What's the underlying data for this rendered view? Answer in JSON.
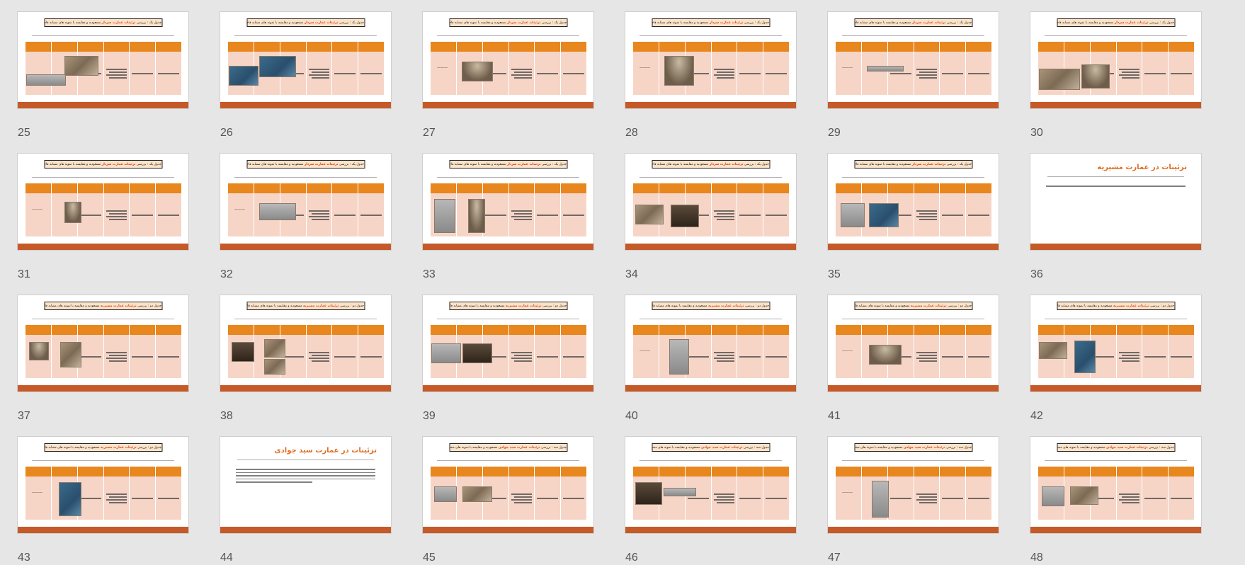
{
  "slides": [
    {
      "num": "25",
      "kind": "table",
      "title_pre": "جدول یک : بررسی",
      "title_hl": "تزئینات عمارت سردار",
      "title_post": "مسعودیه و مقایسه با نمونه های مشابه قاجاری"
    },
    {
      "num": "26",
      "kind": "table",
      "title_pre": "جدول یک : بررسی",
      "title_hl": "تزئینات عمارت سردار",
      "title_post": "مسعودیه و مقایسه با نمونه های مشابه قاجاری"
    },
    {
      "num": "27",
      "kind": "table",
      "title_pre": "جدول یک : بررسی",
      "title_hl": "تزئینات عمارت سردار",
      "title_post": "مسعودیه و مقایسه با نمونه های مشابه قاجاری"
    },
    {
      "num": "28",
      "kind": "table",
      "title_pre": "جدول یک : بررسی",
      "title_hl": "تزئینات عمارت سردار",
      "title_post": "مسعودیه و مقایسه با نمونه های مشابه قاجاری"
    },
    {
      "num": "29",
      "kind": "table",
      "title_pre": "جدول یک : بررسی",
      "title_hl": "تزئینات عمارت سردار",
      "title_post": "مسعودیه و مقایسه با نمونه های مشابه قاجاری"
    },
    {
      "num": "30",
      "kind": "table",
      "title_pre": "جدول یک : بررسی",
      "title_hl": "تزئینات عمارت سردار",
      "title_post": "مسعودیه و مقایسه با نمونه های مشابه قاجاری"
    },
    {
      "num": "31",
      "kind": "table",
      "title_pre": "جدول یک : بررسی",
      "title_hl": "تزئینات عمارت سردار",
      "title_post": "مسعودیه و مقایسه با نمونه های مشابه قاجاری"
    },
    {
      "num": "32",
      "kind": "table",
      "title_pre": "جدول یک : بررسی",
      "title_hl": "تزئینات عمارت سردار",
      "title_post": "مسعودیه و مقایسه با نمونه های مشابه قاجاری"
    },
    {
      "num": "33",
      "kind": "table",
      "title_pre": "جدول یک : بررسی",
      "title_hl": "تزئینات عمارت سردار",
      "title_post": "مسعودیه و مقایسه با نمونه های مشابه قاجاری"
    },
    {
      "num": "34",
      "kind": "table",
      "title_pre": "جدول یک : بررسی",
      "title_hl": "تزئینات عمارت سردار",
      "title_post": "مسعودیه و مقایسه با نمونه های مشابه قاجاری"
    },
    {
      "num": "35",
      "kind": "table",
      "title_pre": "جدول یک : بررسی",
      "title_hl": "تزئینات عمارت سردار",
      "title_post": "مسعودیه و مقایسه با نمونه های مشابه قاجاری"
    },
    {
      "num": "36",
      "kind": "heading",
      "heading": "تزئینات در عمارت مشیریه"
    },
    {
      "num": "37",
      "kind": "table",
      "title_pre": "جدول دو : بررسی",
      "title_hl": "تزئینات عمارت مشیریه",
      "title_post": "مسعودیه و مقایسه با نمونه های مشابه قاجاری"
    },
    {
      "num": "38",
      "kind": "table",
      "title_pre": "جدول دو : بررسی",
      "title_hl": "تزئینات عمارت مشیریه",
      "title_post": "مسعودیه و مقایسه با نمونه های مشابه قاجاری"
    },
    {
      "num": "39",
      "kind": "table",
      "title_pre": "جدول دو : بررسی",
      "title_hl": "تزئینات عمارت مشیریه",
      "title_post": "مسعودیه و مقایسه با نمونه های مشابه قاجاری"
    },
    {
      "num": "40",
      "kind": "table",
      "title_pre": "جدول دو : بررسی",
      "title_hl": "تزئینات عمارت مشیریه",
      "title_post": "مسعودیه و مقایسه با نمونه های مشابه قاجاری"
    },
    {
      "num": "41",
      "kind": "table",
      "title_pre": "جدول دو : بررسی",
      "title_hl": "تزئینات عمارت مشیریه",
      "title_post": "مسعودیه و مقایسه با نمونه های مشابه قاجاری"
    },
    {
      "num": "42",
      "kind": "table",
      "title_pre": "جدول دو : بررسی",
      "title_hl": "تزئینات عمارت مشیریه",
      "title_post": "مسعودیه و مقایسه با نمونه های مشابه قاجاری"
    },
    {
      "num": "43",
      "kind": "table",
      "title_pre": "جدول دو : بررسی",
      "title_hl": "تزئینات عمارت مشیریه",
      "title_post": "مسعودیه و مقایسه با نمونه های مشابه قاجاری"
    },
    {
      "num": "44",
      "kind": "heading",
      "heading": "تزئینات در عمارت سید جوادی"
    },
    {
      "num": "45",
      "kind": "table",
      "title_pre": "جدول سه : بررسی",
      "title_hl": "تزئینات عمارت سید جوادی",
      "title_post": "مسعودیه و مقایسه با نمونه های مشابه قاجاری"
    },
    {
      "num": "46",
      "kind": "table",
      "title_pre": "جدول سه : بررسی",
      "title_hl": "تزئینات عمارت سید جوادی",
      "title_post": "مسعودیه و مقایسه با نمونه های مشابه قاجاری"
    },
    {
      "num": "47",
      "kind": "table",
      "title_pre": "جدول سه : بررسی",
      "title_hl": "تزئینات عمارت سید جوادی",
      "title_post": "مسعودیه و مقایسه با نمونه های مشابه قاجاری"
    },
    {
      "num": "48",
      "kind": "table",
      "title_pre": "جدول سه : بررسی",
      "title_hl": "تزئینات عمارت سید جوادی",
      "title_post": "مسعودیه و مقایسه با نمونه های مشابه قاجاری"
    }
  ],
  "colors": {
    "background": "#e6e6e6",
    "header": "#e8871e",
    "body": "#f6d5c7",
    "footer": "#c55a28",
    "heading": "#e06d22",
    "highlight": "#d23a1a"
  }
}
